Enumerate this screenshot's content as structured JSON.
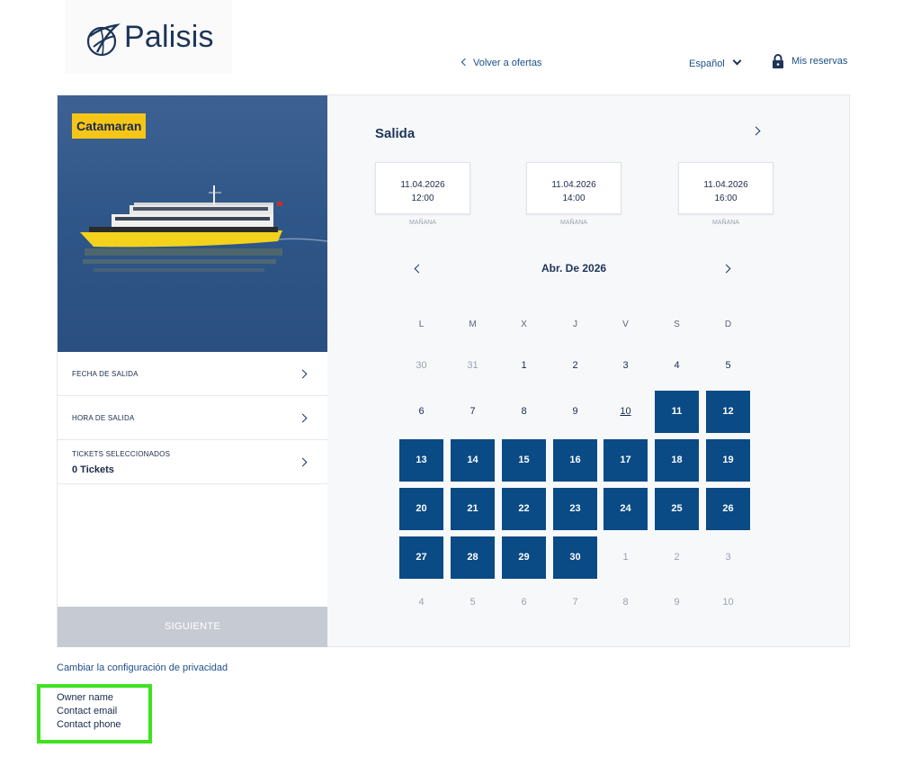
{
  "brand": {
    "name": "Palisis",
    "logo_icon": "globe-sail-logo"
  },
  "nav": {
    "back_label": "Volver a ofertas",
    "language": "Español",
    "reservations_label": "Mis reservas",
    "lock_icon": "lock-icon"
  },
  "product": {
    "badge": "Catamaran",
    "rows": [
      {
        "label": "FECHA DE SALIDA",
        "value": ""
      },
      {
        "label": "HORA DE SALIDA",
        "value": ""
      },
      {
        "label": "TICKETS SELECCIONADOS",
        "value": "0 Tickets"
      }
    ],
    "next_button": "SIGUIENTE"
  },
  "departure": {
    "title": "Salida",
    "slots": [
      {
        "date": "11.04.2026",
        "time": "12:00",
        "sub": "MAÑANA"
      },
      {
        "date": "11.04.2026",
        "time": "14:00",
        "sub": "MAÑANA"
      },
      {
        "date": "11.04.2026",
        "time": "16:00",
        "sub": "MAÑANA"
      }
    ]
  },
  "calendar": {
    "month_label": "Abr. De 2026",
    "weekdays": [
      "L",
      "M",
      "X",
      "J",
      "V",
      "S",
      "D"
    ],
    "weeks": [
      [
        {
          "d": "30",
          "s": "muted"
        },
        {
          "d": "31",
          "s": "muted"
        },
        {
          "d": "1",
          "s": "normal"
        },
        {
          "d": "2",
          "s": "normal"
        },
        {
          "d": "3",
          "s": "normal"
        },
        {
          "d": "4",
          "s": "normal"
        },
        {
          "d": "5",
          "s": "normal"
        }
      ],
      [
        {
          "d": "6",
          "s": "normal"
        },
        {
          "d": "7",
          "s": "normal"
        },
        {
          "d": "8",
          "s": "normal"
        },
        {
          "d": "9",
          "s": "normal"
        },
        {
          "d": "10",
          "s": "today"
        },
        {
          "d": "11",
          "s": "avail"
        },
        {
          "d": "12",
          "s": "avail"
        }
      ],
      [
        {
          "d": "13",
          "s": "avail"
        },
        {
          "d": "14",
          "s": "avail"
        },
        {
          "d": "15",
          "s": "avail"
        },
        {
          "d": "16",
          "s": "avail"
        },
        {
          "d": "17",
          "s": "avail"
        },
        {
          "d": "18",
          "s": "avail"
        },
        {
          "d": "19",
          "s": "avail"
        }
      ],
      [
        {
          "d": "20",
          "s": "avail"
        },
        {
          "d": "21",
          "s": "avail"
        },
        {
          "d": "22",
          "s": "avail"
        },
        {
          "d": "23",
          "s": "avail"
        },
        {
          "d": "24",
          "s": "avail"
        },
        {
          "d": "25",
          "s": "avail"
        },
        {
          "d": "26",
          "s": "avail"
        }
      ],
      [
        {
          "d": "27",
          "s": "avail"
        },
        {
          "d": "28",
          "s": "avail"
        },
        {
          "d": "29",
          "s": "avail"
        },
        {
          "d": "30",
          "s": "avail"
        },
        {
          "d": "1",
          "s": "muted"
        },
        {
          "d": "2",
          "s": "muted"
        },
        {
          "d": "3",
          "s": "muted"
        }
      ],
      [
        {
          "d": "4",
          "s": "muted"
        },
        {
          "d": "5",
          "s": "muted"
        },
        {
          "d": "6",
          "s": "muted"
        },
        {
          "d": "7",
          "s": "muted"
        },
        {
          "d": "8",
          "s": "muted"
        },
        {
          "d": "9",
          "s": "muted"
        },
        {
          "d": "10",
          "s": "muted"
        }
      ]
    ]
  },
  "footer": {
    "privacy_link": "Cambiar la configuración de privacidad",
    "contact": [
      "Owner name",
      "Contact email",
      "Contact phone"
    ]
  },
  "colors": {
    "primary": "#0a4a85",
    "badge": "#f5c518",
    "highlight": "#3ee21f",
    "disabled": "#c6cad3"
  }
}
